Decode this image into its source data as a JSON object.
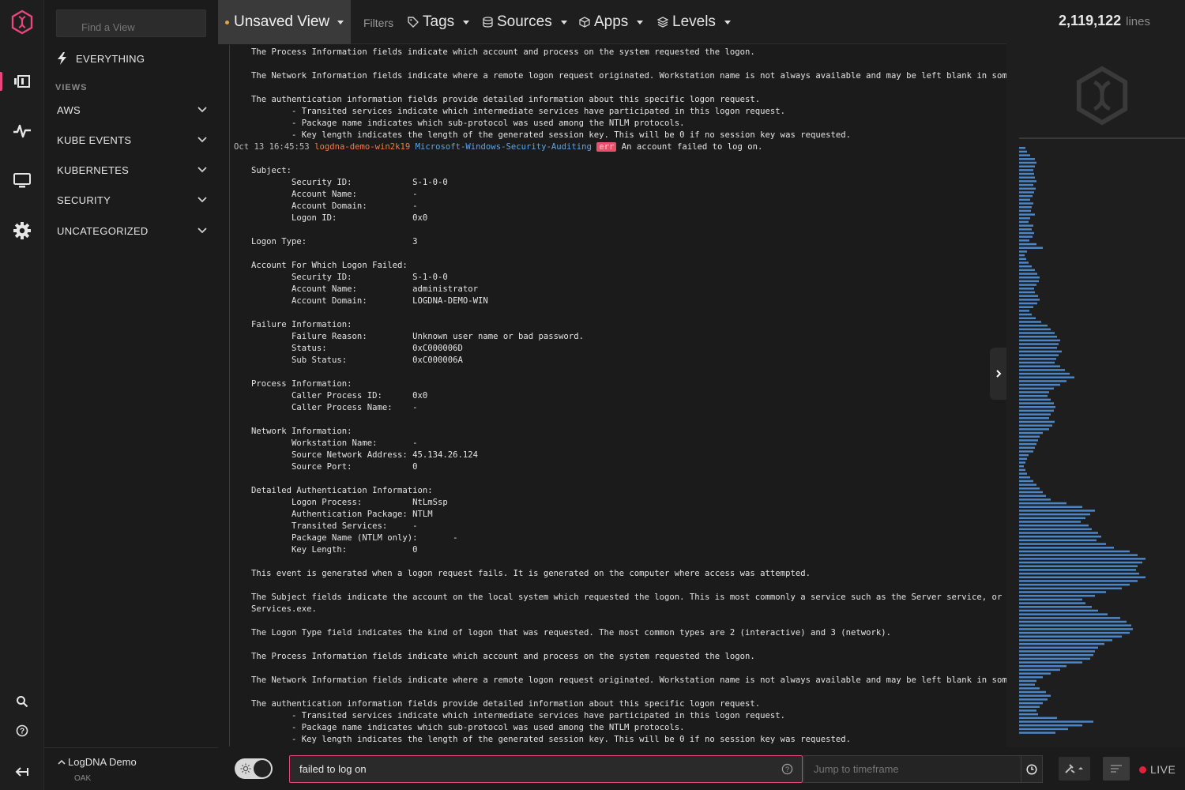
{
  "sidebar": {
    "find_placeholder": "Find a View",
    "everything_label": "EVERYTHING",
    "views_heading": "VIEWS",
    "categories": [
      "AWS",
      "KUBE EVENTS",
      "KUBERNETES",
      "SECURITY",
      "UNCATEGORIZED"
    ],
    "org_name": "LogDNA Demo",
    "org_sub": "OAK"
  },
  "topbar": {
    "view_title": "Unsaved View",
    "filters_label": "Filters",
    "tags_label": "Tags",
    "sources_label": "Sources",
    "apps_label": "Apps",
    "levels_label": "Levels"
  },
  "stats": {
    "line_count": "2,119,122",
    "lines_word": "lines"
  },
  "log_header": {
    "timestamp": "Oct 13 16:45:53",
    "host": "logdna-demo-win2k19",
    "app": "Microsoft-Windows-Security-Auditing",
    "level": "err",
    "message": "An account failed to log on."
  },
  "log_lines_before": [
    "The Process Information fields indicate which account and process on the system requested the logon.",
    "",
    "The Network Information fields indicate where a remote logon request originated. Workstation name is not always available and may be left blank in some cases.",
    "",
    "The authentication information fields provide detailed information about this specific logon request.",
    "        - Transited services indicate which intermediate services have participated in this logon request.",
    "        - Package name indicates which sub-protocol was used among the NTLM protocols.",
    "        - Key length indicates the length of the generated session key. This will be 0 if no session key was requested."
  ],
  "log_lines_after": [
    "",
    "Subject:",
    "        Security ID:            S-1-0-0",
    "        Account Name:           -",
    "        Account Domain:         -",
    "        Logon ID:               0x0",
    "",
    "Logon Type:                     3",
    "",
    "Account For Which Logon Failed:",
    "        Security ID:            S-1-0-0",
    "        Account Name:           administrator",
    "        Account Domain:         LOGDNA-DEMO-WIN",
    "",
    "Failure Information:",
    "        Failure Reason:         Unknown user name or bad password.",
    "        Status:                 0xC000006D",
    "        Sub Status:             0xC000006A",
    "",
    "Process Information:",
    "        Caller Process ID:      0x0",
    "        Caller Process Name:    -",
    "",
    "Network Information:",
    "        Workstation Name:       -",
    "        Source Network Address: 45.134.26.124",
    "        Source Port:            0",
    "",
    "Detailed Authentication Information:",
    "        Logon Process:          NtLmSsp",
    "        Authentication Package: NTLM",
    "        Transited Services:     -",
    "        Package Name (NTLM only):       -",
    "        Key Length:             0",
    "",
    "This event is generated when a logon request fails. It is generated on the computer where access was attempted.",
    "",
    "The Subject fields indicate the account on the local system which requested the logon. This is most commonly a service such as the Server service, or a local pr",
    "Services.exe.",
    "",
    "The Logon Type field indicates the kind of logon that was requested. The most common types are 2 (interactive) and 3 (network).",
    "",
    "The Process Information fields indicate which account and process on the system requested the logon.",
    "",
    "The Network Information fields indicate where a remote logon request originated. Workstation name is not always available and may be left blank in some cases.",
    "",
    "The authentication information fields provide detailed information about this specific logon request.",
    "        - Transited services indicate which intermediate services have participated in this logon request.",
    "        - Package name indicates which sub-protocol was used among the NTLM protocols.",
    "        - Key length indicates the length of the generated session key. This will be 0 if no session key was requested."
  ],
  "histogram": {
    "color": "#4a86c8",
    "bars": [
      8,
      10,
      14,
      20,
      22,
      20,
      18,
      19,
      20,
      22,
      18,
      21,
      19,
      17,
      14,
      18,
      16,
      15,
      20,
      14,
      12,
      18,
      16,
      19,
      17,
      13,
      22,
      30,
      10,
      7,
      9,
      12,
      16,
      20,
      23,
      26,
      25,
      22,
      19,
      20,
      24,
      26,
      23,
      18,
      13,
      16,
      21,
      28,
      36,
      40,
      45,
      48,
      52,
      50,
      48,
      54,
      50,
      47,
      45,
      52,
      58,
      64,
      70,
      60,
      52,
      44,
      38,
      36,
      40,
      44,
      46,
      44,
      40,
      38,
      45,
      42,
      38,
      30,
      26,
      24,
      22,
      20,
      18,
      12,
      10,
      8,
      6,
      8,
      10,
      14,
      18,
      22,
      26,
      30,
      34,
      40,
      60,
      80,
      96,
      90,
      84,
      78,
      88,
      92,
      100,
      104,
      98,
      110,
      120,
      140,
      150,
      160,
      156,
      150,
      148,
      152,
      160,
      150,
      140,
      130,
      110,
      96,
      80,
      84,
      92,
      100,
      112,
      128,
      136,
      142,
      144,
      140,
      130,
      118,
      108,
      100,
      96,
      94,
      90,
      80,
      60,
      52,
      40,
      30,
      22,
      20,
      26,
      34,
      40,
      36,
      30,
      26,
      22,
      24,
      48,
      94,
      80,
      62,
      46
    ]
  },
  "bottombar": {
    "search_value": "failed to log on",
    "jump_placeholder": "Jump to timeframe",
    "live_label": "LIVE"
  },
  "colors": {
    "accent": "#e8467c",
    "host": "#f07a4a",
    "app": "#5ea4e8",
    "level_err": "#e8506a",
    "live": "#e0233c"
  }
}
